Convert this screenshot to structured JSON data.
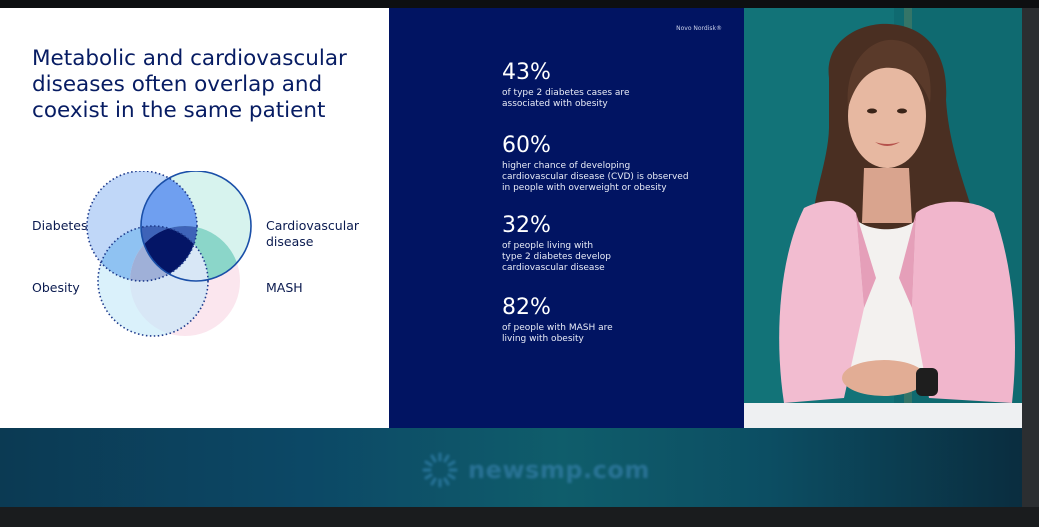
{
  "slide": {
    "title": "Metabolic and cardiovascular\ndiseases often overlap and\ncoexist in the same patient",
    "venn_labels": {
      "diabetes": "Diabetes",
      "cardiovascular": "Cardiovascular\ndisease",
      "obesity": "Obesity",
      "mash": "MASH"
    },
    "colors": {
      "title": "#071c63",
      "navy_panel": "#011462",
      "diabetes_circle": "#5b8ee8",
      "cardio_circle": "#7fd6c8",
      "obesity_circle": "#bfe6f7",
      "mash_circle": "#f6d9e3"
    }
  },
  "stats_panel": {
    "brand": "Novo Nordisk®",
    "stats": [
      {
        "value": "43%",
        "description": "of type 2 diabetes cases are\nassociated with obesity"
      },
      {
        "value": "60%",
        "description": "higher chance of developing\ncardiovascular disease (CVD) is observed\nin people with overweight or obesity"
      },
      {
        "value": "32%",
        "description": "of people living with\ntype 2 diabetes develop\ncardiovascular disease"
      },
      {
        "value": "82%",
        "description": "of people with MASH are\nliving with obesity"
      }
    ]
  },
  "watermark": {
    "text": "newsmp.com",
    "icon": "sunburst-logo-icon"
  }
}
